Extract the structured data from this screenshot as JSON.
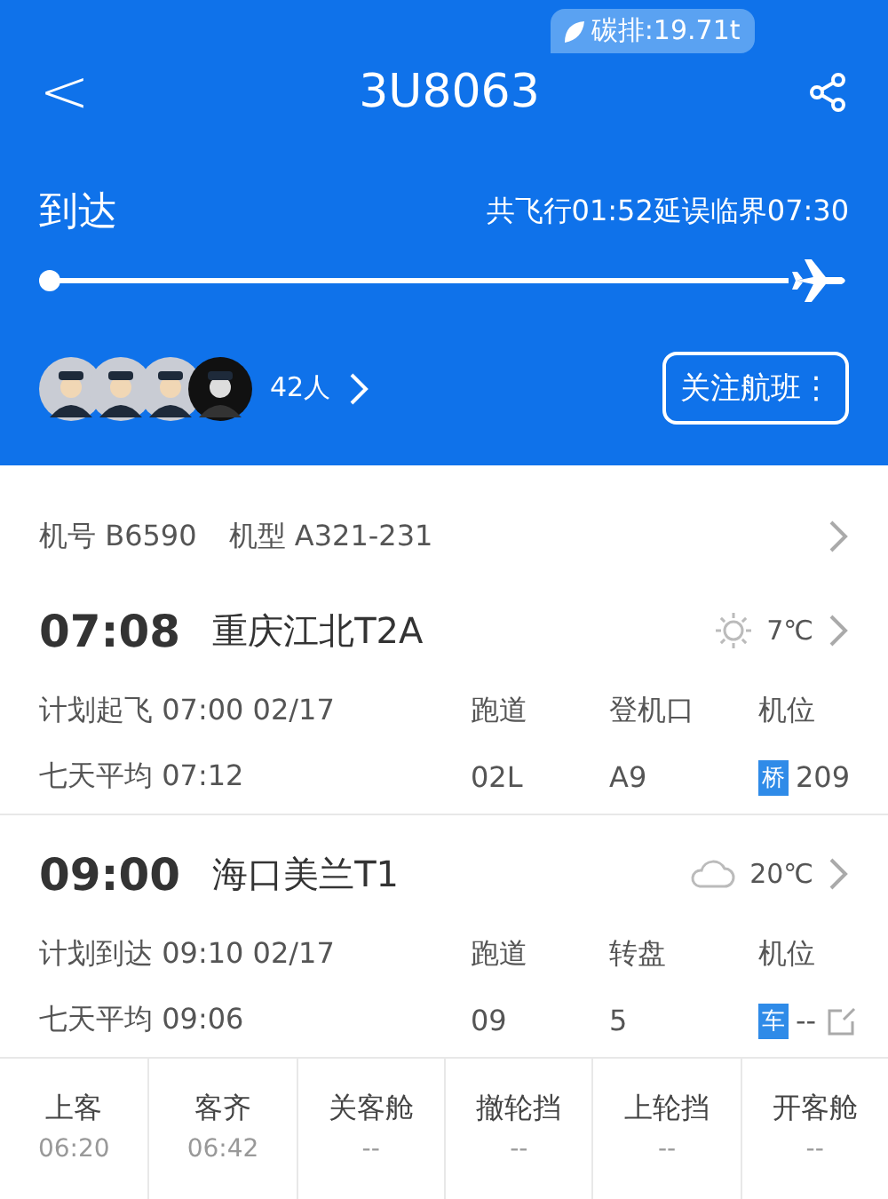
{
  "header": {
    "back": "<",
    "flight_no": "3U8063",
    "carbon": "碳排:19.71t",
    "status": "到达",
    "flight_info": "共飞行01:52延误临界07:30",
    "crew_count": "42人",
    "follow_button": "关注航班⋮"
  },
  "aircraft": {
    "reg_label": "机号",
    "reg": "B6590",
    "type_label": "机型",
    "type": "A321-231"
  },
  "legs": [
    {
      "time": "07:08",
      "airport": "重庆江北T2A",
      "weather": {
        "kind": "sunny"
      },
      "temp": "7℃",
      "plan": "计划起飞 07:00 02/17",
      "avg": "七天平均 07:12",
      "cols": [
        {
          "label": "跑道",
          "value": "02L"
        },
        {
          "label": "登机口",
          "value": "A9"
        },
        {
          "label": "机位",
          "tag": "桥",
          "value": "209",
          "editable": false
        }
      ]
    },
    {
      "time": "09:00",
      "airport": "海口美兰T1",
      "weather": {
        "kind": "cloudy"
      },
      "temp": "20℃",
      "plan": "计划到达 09:10 02/17",
      "avg": "七天平均 09:06",
      "cols": [
        {
          "label": "跑道",
          "value": "09"
        },
        {
          "label": "转盘",
          "value": "5"
        },
        {
          "label": "机位",
          "tag": "车",
          "value": "--",
          "editable": true
        }
      ]
    }
  ],
  "milestones": [
    {
      "label": "上客",
      "time": "06:20"
    },
    {
      "label": "客齐",
      "time": "06:42"
    },
    {
      "label": "关客舱",
      "time": "--"
    },
    {
      "label": "撤轮挡",
      "time": "--"
    },
    {
      "label": "上轮挡",
      "time": "--"
    },
    {
      "label": "开客舱",
      "time": "--"
    }
  ]
}
